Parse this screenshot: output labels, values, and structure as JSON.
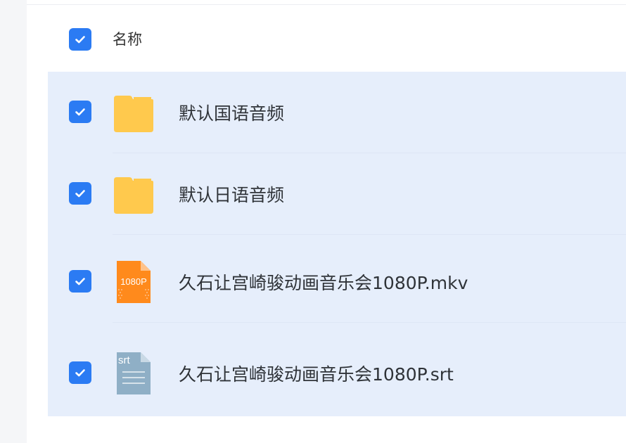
{
  "header": {
    "checked": true,
    "column_label": "名称"
  },
  "files": [
    {
      "name": "默认国语音频",
      "type": "folder",
      "checked": true
    },
    {
      "name": "默认日语音频",
      "type": "folder",
      "checked": true
    },
    {
      "name": "久石让宫崎骏动画音乐会1080P.mkv",
      "type": "video",
      "icon_label": "1080P",
      "checked": true
    },
    {
      "name": "久石让宫崎骏动画音乐会1080P.srt",
      "type": "subtitle",
      "icon_label": "srt",
      "checked": true
    }
  ],
  "colors": {
    "accent": "#2b7bf3",
    "selected_bg": "#e6eefb",
    "folder": "#ffc94d",
    "video_icon": "#ff8a1c",
    "subtitle_icon": "#8fafc6"
  }
}
